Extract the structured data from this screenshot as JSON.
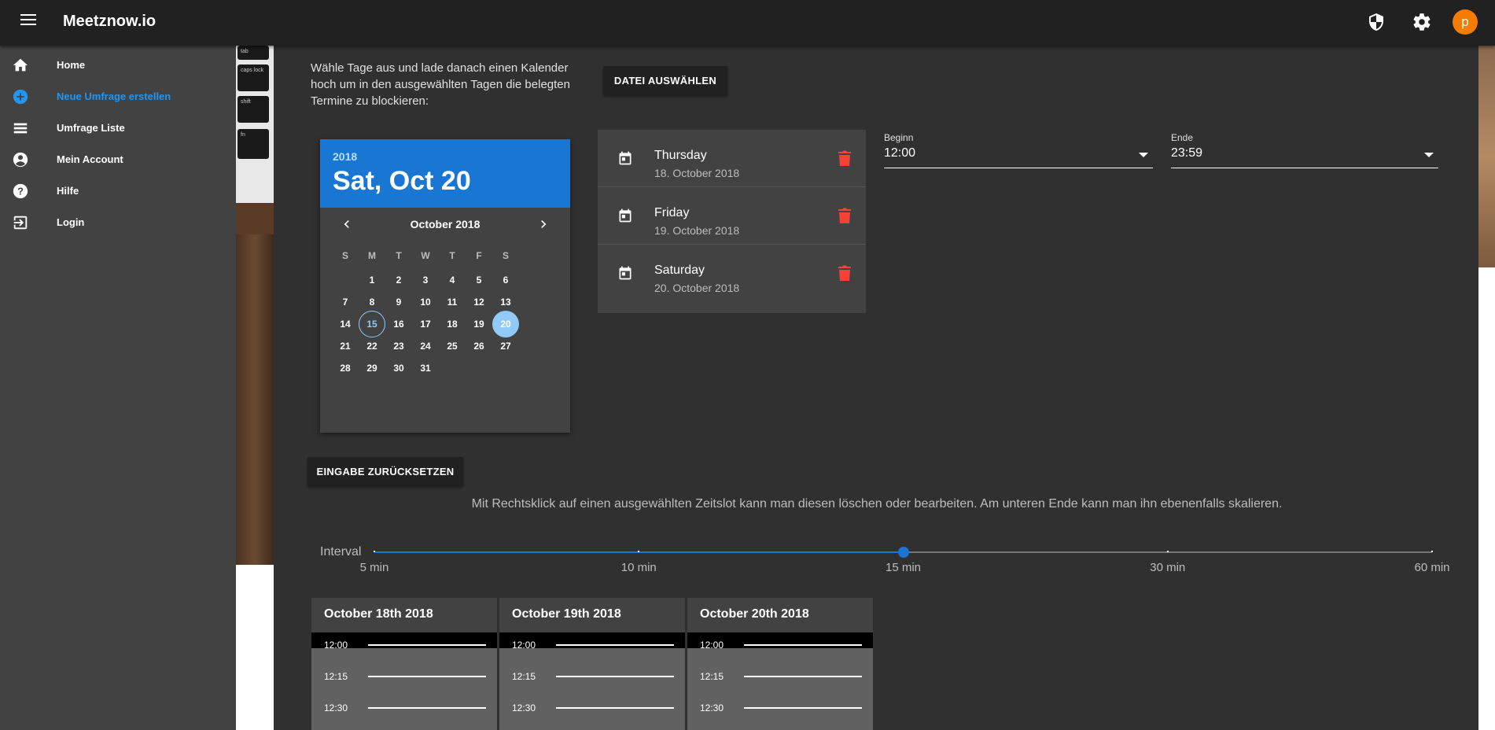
{
  "app": {
    "title": "Meetznow.io",
    "avatar_letter": "p"
  },
  "sidebar": {
    "items": [
      {
        "label": "Home",
        "icon": "home-icon",
        "active": false
      },
      {
        "label": "Neue Umfrage erstellen",
        "icon": "add-circle-icon",
        "active": true
      },
      {
        "label": "Umfrage Liste",
        "icon": "list-icon",
        "active": false
      },
      {
        "label": "Mein Account",
        "icon": "account-circle-icon",
        "active": false
      },
      {
        "label": "Hilfe",
        "icon": "help-icon",
        "active": false
      },
      {
        "label": "Login",
        "icon": "login-icon",
        "active": false
      }
    ]
  },
  "background_keys": [
    "tab",
    "caps lock",
    "shift",
    "fn"
  ],
  "intro": "Wähle Tage aus und lade danach einen Kalender hoch um in den ausgewählten Tagen die belegten Termine zu blockieren:",
  "file_button": "DATEI AUSWÄHLEN",
  "reset_button": "EINGABE ZURÜCKSETZEN",
  "picker": {
    "year": "2018",
    "selected_date": "Sat, Oct 20",
    "month": "October 2018",
    "weekdays": [
      "S",
      "M",
      "T",
      "W",
      "T",
      "F",
      "S"
    ],
    "first_weekday_index": 1,
    "days_in_month": 31,
    "today": 15,
    "selected": 20
  },
  "selected_days": [
    {
      "name": "Thursday",
      "date": "18. October 2018"
    },
    {
      "name": "Friday",
      "date": "19. October 2018"
    },
    {
      "name": "Saturday",
      "date": "20. October 2018"
    }
  ],
  "time_range": {
    "begin_label": "Beginn",
    "begin_value": "12:00",
    "end_label": "Ende",
    "end_value": "23:59"
  },
  "hint": "Mit Rechtsklick auf einen ausgewählten Zeitslot kann man diesen löschen oder bearbeiten. Am unteren Ende kann man ihn ebenenfalls skalieren.",
  "interval": {
    "label": "Interval",
    "marks": [
      "5 min",
      "10 min",
      "15 min",
      "30 min",
      "60 min"
    ],
    "selected_index": 2
  },
  "schedule": {
    "columns": [
      "October 18th 2018",
      "October 19th 2018",
      "October 20th 2018"
    ],
    "slots": [
      "12:00",
      "12:15",
      "12:30"
    ]
  },
  "colors": {
    "accent": "#1976d2",
    "delete": "#f44336",
    "avatar": "#f57c00"
  }
}
